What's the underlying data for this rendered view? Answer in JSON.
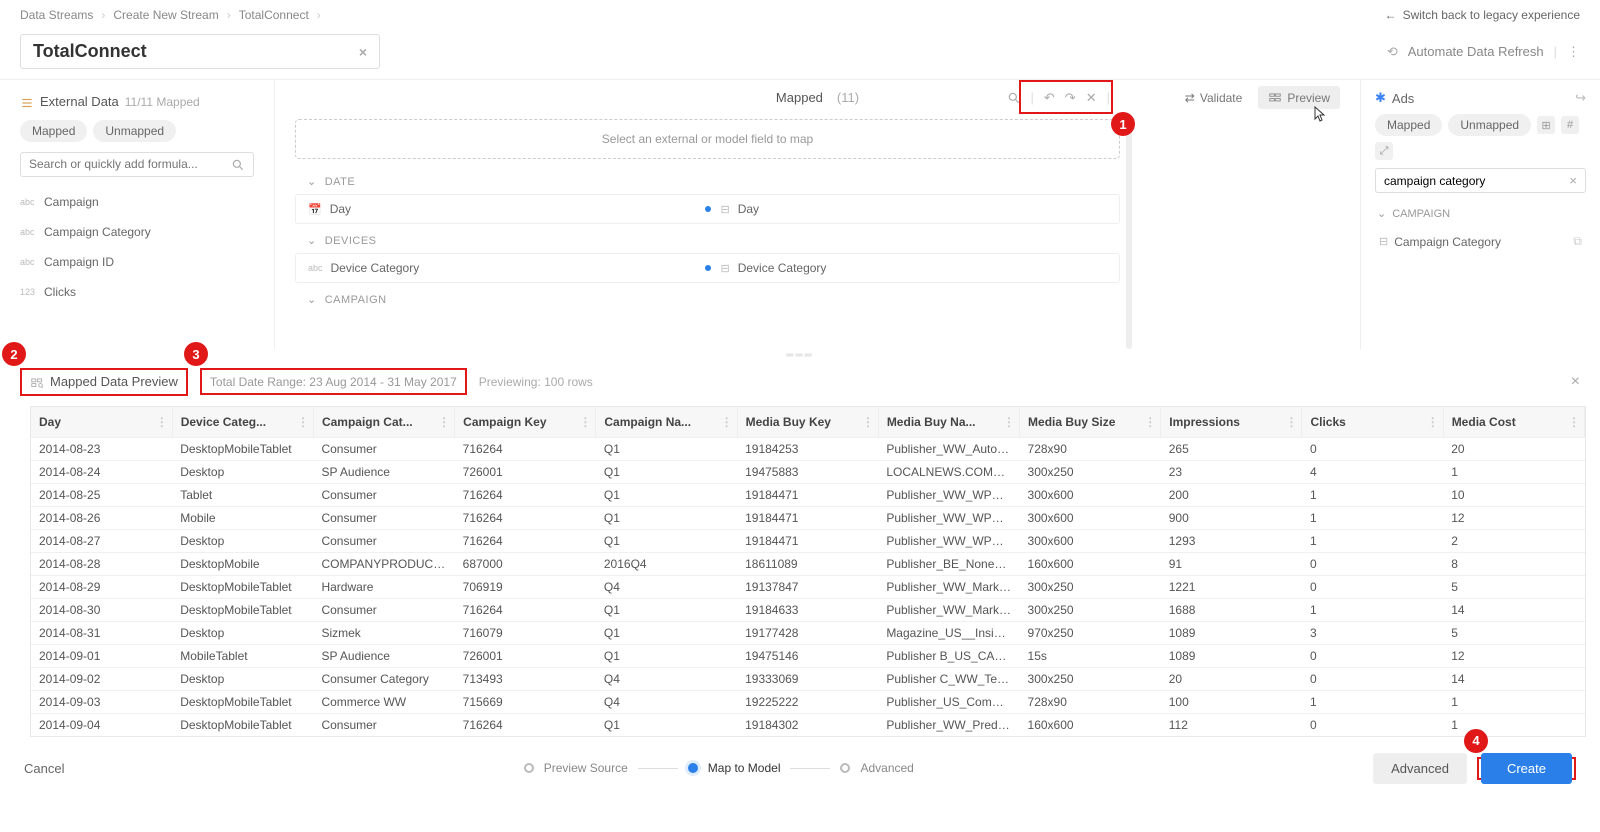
{
  "breadcrumb": [
    "Data Streams",
    "Create New Stream",
    "TotalConnect"
  ],
  "legacy_link": "Switch back to legacy experience",
  "title": "TotalConnect",
  "automate": "Automate Data Refresh",
  "left": {
    "header": "External Data",
    "count": "11/11 Mapped",
    "pills": [
      "Mapped",
      "Unmapped"
    ],
    "search_ph": "Search or quickly add formula...",
    "fields": [
      {
        "type": "abc",
        "label": "Campaign"
      },
      {
        "type": "abc",
        "label": "Campaign Category"
      },
      {
        "type": "abc",
        "label": "Campaign ID"
      },
      {
        "type": "123",
        "label": "Clicks"
      }
    ]
  },
  "center": {
    "mapped_label": "Mapped",
    "mapped_count": "(11)",
    "validate": "Validate",
    "preview": "Preview",
    "drop_hint": "Select an external or model field to map",
    "groups": [
      {
        "name": "DATE",
        "rows": [
          {
            "left": "Day",
            "ltype": "cal",
            "right": "Day"
          }
        ]
      },
      {
        "name": "DEVICES",
        "rows": [
          {
            "left": "Device Category",
            "ltype": "abc",
            "right": "Device Category"
          }
        ]
      },
      {
        "name": "CAMPAIGN",
        "rows": []
      }
    ]
  },
  "right": {
    "header": "Ads",
    "pills": [
      "Mapped",
      "Unmapped"
    ],
    "search_value": "campaign category",
    "group": "CAMPAIGN",
    "item": "Campaign Category"
  },
  "preview": {
    "title": "Mapped Data Preview",
    "range": "Total Date Range: 23 Aug 2014 - 31 May 2017",
    "rows_label": "Previewing: 100 rows"
  },
  "table": {
    "headers": [
      "Day",
      "Device Categ...",
      "Campaign Cat...",
      "Campaign Key",
      "Campaign Na...",
      "Media Buy Key",
      "Media Buy Na...",
      "Media Buy Size",
      "Impressions",
      "Clicks",
      "Media Cost"
    ],
    "rows": [
      [
        "2014-08-23",
        "DesktopMobileTablet",
        "Consumer",
        "716264",
        "Q1",
        "19184253",
        "Publisher_WW_Automo",
        "728x90",
        "265",
        "0",
        "20"
      ],
      [
        "2014-08-24",
        "Desktop",
        "SP Audience",
        "726001",
        "Q1",
        "19475883",
        "LOCALNEWS.COM_MM.",
        "300x250",
        "23",
        "4",
        "1"
      ],
      [
        "2014-08-25",
        "Tablet",
        "Consumer",
        "716264",
        "Q1",
        "19184471",
        "Publisher_WW_WPP_Re",
        "300x600",
        "200",
        "1",
        "10"
      ],
      [
        "2014-08-26",
        "Mobile",
        "Consumer",
        "716264",
        "Q1",
        "19184471",
        "Publisher_WW_WPP_Re",
        "300x600",
        "900",
        "1",
        "12"
      ],
      [
        "2014-08-27",
        "Desktop",
        "Consumer",
        "716264",
        "Q1",
        "19184471",
        "Publisher_WW_WPP_Re",
        "300x600",
        "1293",
        "1",
        "2"
      ],
      [
        "2014-08-28",
        "DesktopMobile",
        "COMPANYPRODUCT Ma",
        "687000",
        "2016Q4",
        "18611089",
        "Publisher_BE_None_CD(",
        "160x600",
        "91",
        "0",
        "8"
      ],
      [
        "2014-08-29",
        "DesktopMobileTablet",
        "Hardware",
        "706919",
        "Q4",
        "19137847",
        "Publisher_WW_Marketi",
        "300x250",
        "1221",
        "0",
        "5"
      ],
      [
        "2014-08-30",
        "DesktopMobileTablet",
        "Consumer",
        "716264",
        "Q1",
        "19184633",
        "Publisher_WW_Marketi",
        "300x250",
        "1688",
        "1",
        "14"
      ],
      [
        "2014-08-31",
        "Desktop",
        "Sizmek",
        "716079",
        "Q1",
        "19177428",
        "Magazine_US__Insight S",
        "970x250",
        "1089",
        "3",
        "5"
      ],
      [
        "2014-09-01",
        "MobileTablet",
        "SP Audience",
        "726001",
        "Q1",
        "19475146",
        "Publisher B_US_CA_Aud",
        "15s",
        "1089",
        "0",
        "12"
      ],
      [
        "2014-09-02",
        "Desktop",
        "Consumer Category",
        "713493",
        "Q4",
        "19333069",
        "Publisher C_WW_Tech A",
        "300x250",
        "20",
        "0",
        "14"
      ],
      [
        "2014-09-03",
        "DesktopMobileTablet",
        "Commerce WW",
        "715669",
        "Q4",
        "19225222",
        "Publisher_US_Commerc",
        "728x90",
        "100",
        "1",
        "1"
      ],
      [
        "2014-09-04",
        "DesktopMobileTablet",
        "Consumer",
        "716264",
        "Q1",
        "19184302",
        "Publisher_WW_Predictc",
        "160x600",
        "112",
        "0",
        "1"
      ]
    ]
  },
  "footer": {
    "cancel": "Cancel",
    "steps": [
      "Preview Source",
      "Map to Model",
      "Advanced"
    ],
    "advanced": "Advanced",
    "create": "Create"
  },
  "badges": {
    "b1": "1",
    "b2": "2",
    "b3": "3",
    "b4": "4"
  }
}
